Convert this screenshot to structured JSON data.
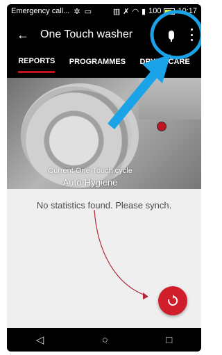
{
  "status_bar": {
    "left_text": "Emergency call...",
    "battery_text": "100",
    "time": "10:17"
  },
  "app_bar": {
    "back_icon": "arrow-left-icon",
    "title": "One Touch washer",
    "mic_icon": "microphone-icon",
    "menu_icon": "more-vertical-icon"
  },
  "tabs": [
    {
      "label": "REPORTS",
      "active": true
    },
    {
      "label": "PROGRAMMES",
      "active": false
    },
    {
      "label": "DRYER CARE",
      "active": false
    }
  ],
  "hero": {
    "cycle_label": "Current One-Touch cycle",
    "cycle_value": "Auto-Hygiene"
  },
  "content": {
    "message": "No statistics found. Please synch."
  },
  "fab": {
    "icon": "sync-icon"
  },
  "nav_bar": {
    "back_icon": "nav-back-icon",
    "home_icon": "nav-home-icon",
    "recents_icon": "nav-recents-icon"
  },
  "colors": {
    "accent_red": "#c0151f",
    "annotation_blue": "#1aa3e8",
    "annotation_arrow_red": "#b0283a"
  }
}
